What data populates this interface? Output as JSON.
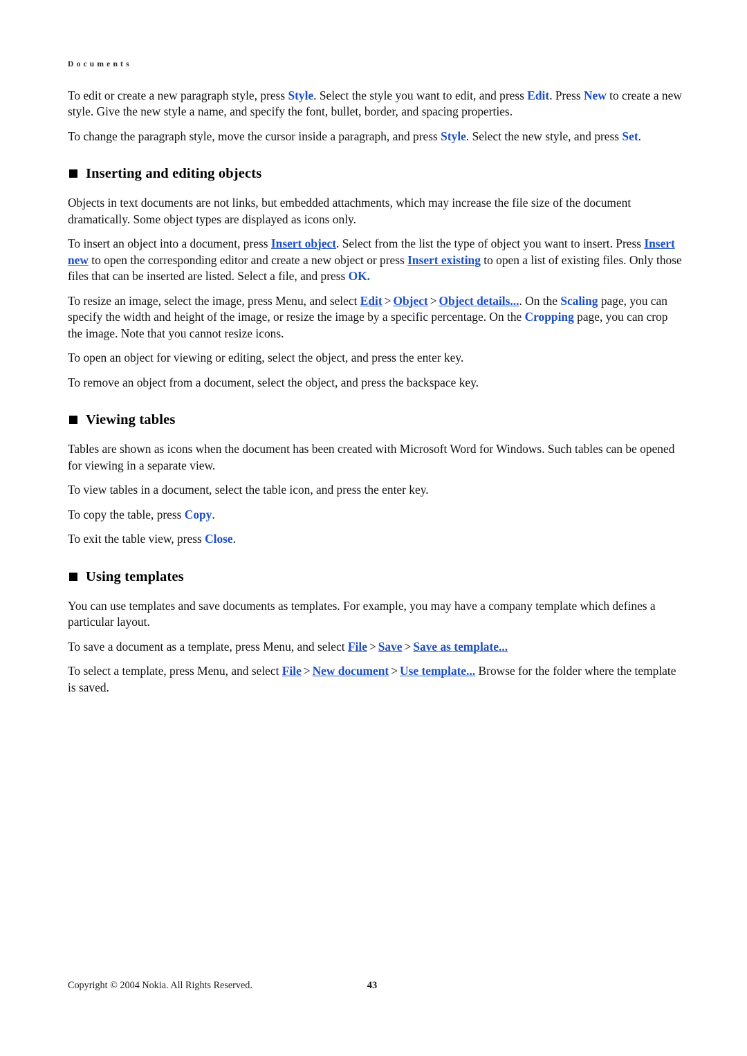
{
  "document": {
    "running_head": "Documents",
    "accent_color": "#1c4fc4",
    "page_number": "43",
    "copyright": "Copyright © 2004 Nokia. All Rights Reserved."
  },
  "intro": {
    "para1": {
      "s1": "To edit or create a new paragraph style, press ",
      "cmd1": "Style",
      "s2": ". Select the style you want to edit, and press ",
      "cmd2": "Edit",
      "s3": ". Press ",
      "cmd3": "New",
      "s4": " to create a new style. Give the new style a name, and specify the font, bullet, border, and spacing properties."
    },
    "para2": {
      "s1": "To change the paragraph style, move the cursor inside a paragraph, and press ",
      "cmd1": "Style",
      "s2": ". Select the new style, and press ",
      "cmd2": "Set",
      "s3": "."
    }
  },
  "section_objects": {
    "heading": "Inserting and editing objects",
    "para1": "Objects in text documents are not links, but embedded attachments, which may increase the file size of the document dramatically. Some object types are displayed as icons only.",
    "para2": {
      "s1": "To insert an object into a document, press ",
      "cmd1": "Insert object",
      "s2": ". Select from the list the type of object you want to insert. Press ",
      "cmd2": "Insert new",
      "s3": " to open the corresponding editor and create a new object or press ",
      "cmd3": "Insert existing",
      "s4": " to open a list of existing files. Only those files that can be inserted are listed. Select a file, and press ",
      "cmd4": "OK."
    },
    "para3": {
      "s1": "To resize an image, select the image, press Menu, and select ",
      "cmd1": "Edit",
      "arrow1": ">",
      "cmd2": "Object",
      "arrow2": ">",
      "cmd3": "Object details...",
      "s2": ". On the ",
      "cmd4": "Scaling",
      "s3": " page, you can specify the width and height of the image, or resize the image by a specific percentage. On the ",
      "cmd5": "Cropping",
      "s4": " page, you can crop the image. Note that you cannot resize icons."
    },
    "para4": "To open an object for viewing or editing, select the object, and press the enter key.",
    "para5": "To remove an object from a document, select the object, and press the backspace key."
  },
  "section_tables": {
    "heading": "Viewing tables",
    "para1": "Tables are shown as icons when the document has been created with Microsoft Word for Windows. Such tables can be opened for viewing in a separate view.",
    "para2": "To view tables in a document, select the table icon, and press the enter key.",
    "para3": {
      "s1": "To copy the table, press ",
      "cmd1": "Copy",
      "s2": "."
    },
    "para4": {
      "s1": "To exit the table view, press ",
      "cmd1": "Close",
      "s2": "."
    }
  },
  "section_templates": {
    "heading": "Using templates",
    "para1": "You can use templates and save documents as templates. For example, you may have a company template which defines a particular layout.",
    "para2": {
      "s1": "To save a document as a template, press Menu, and select ",
      "cmd1": "File",
      "arrow1": ">",
      "cmd2": "Save",
      "arrow2": ">",
      "cmd3": "Save as template..."
    },
    "para3": {
      "s1": "To select a template, press Menu, and select ",
      "cmd1": "File",
      "arrow1": ">",
      "cmd2": "New document",
      "arrow2": ">",
      "cmd3": "Use template...",
      "s2": " Browse for the folder where the template is saved."
    }
  }
}
